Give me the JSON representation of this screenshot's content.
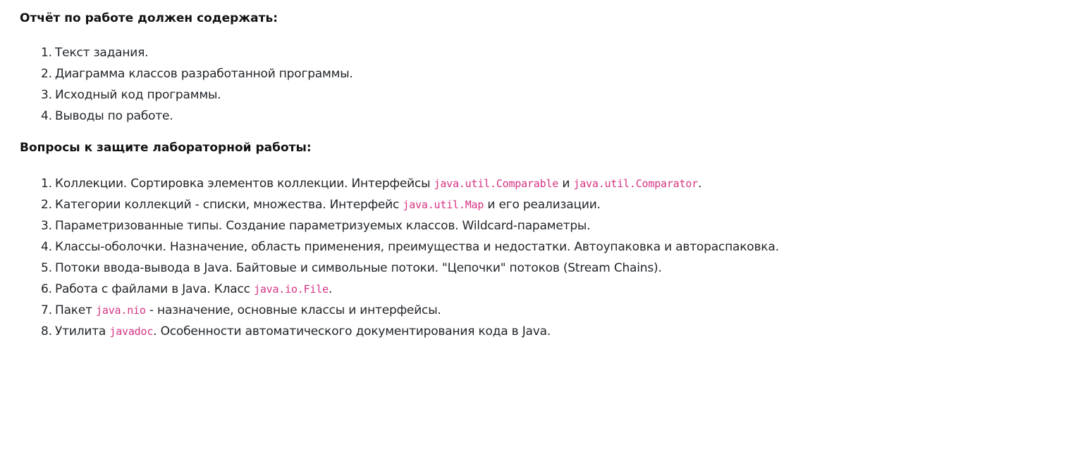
{
  "report": {
    "heading": "Отчёт по работе должен содержать:",
    "items": [
      {
        "num": "1.",
        "text": "Текст задания."
      },
      {
        "num": "2.",
        "text": "Диаграмма классов разработанной программы."
      },
      {
        "num": "3.",
        "text": "Исходный код программы."
      },
      {
        "num": "4.",
        "text": "Выводы по работе."
      }
    ]
  },
  "questions": {
    "heading": "Вопросы к защите лабораторной работы:",
    "items": [
      {
        "num": "1.",
        "parts": [
          {
            "t": "Коллекции. Сортировка элементов коллекции. Интерфейсы "
          },
          {
            "c": "java.util.Comparable"
          },
          {
            "t": " и "
          },
          {
            "c": "java.util.Comparator"
          },
          {
            "t": "."
          }
        ]
      },
      {
        "num": "2.",
        "parts": [
          {
            "t": "Категории коллекций - списки, множества. Интерфейс "
          },
          {
            "c": "java.util.Map"
          },
          {
            "t": " и его реализации."
          }
        ]
      },
      {
        "num": "3.",
        "parts": [
          {
            "t": "Параметризованные типы. Создание параметризуемых классов. Wildcard-параметры."
          }
        ]
      },
      {
        "num": "4.",
        "parts": [
          {
            "t": "Классы-оболочки. Назначение, область применения, преимущества и недостатки. Автоупаковка и автораспаковка."
          }
        ]
      },
      {
        "num": "5.",
        "parts": [
          {
            "t": "Потоки ввода-вывода в Java. Байтовые и символьные потоки. \"Цепочки\" потоков (Stream Chains)."
          }
        ]
      },
      {
        "num": "6.",
        "parts": [
          {
            "t": "Работа с файлами в Java. Класс "
          },
          {
            "c": "java.io.File"
          },
          {
            "t": "."
          }
        ]
      },
      {
        "num": "7.",
        "parts": [
          {
            "t": "Пакет "
          },
          {
            "c": "java.nio"
          },
          {
            "t": " - назначение, основные классы и интерфейсы."
          }
        ]
      },
      {
        "num": "8.",
        "parts": [
          {
            "t": "Утилита "
          },
          {
            "c": "javadoc"
          },
          {
            "t": ". Особенности автоматического документирования кода в Java."
          }
        ]
      }
    ]
  }
}
